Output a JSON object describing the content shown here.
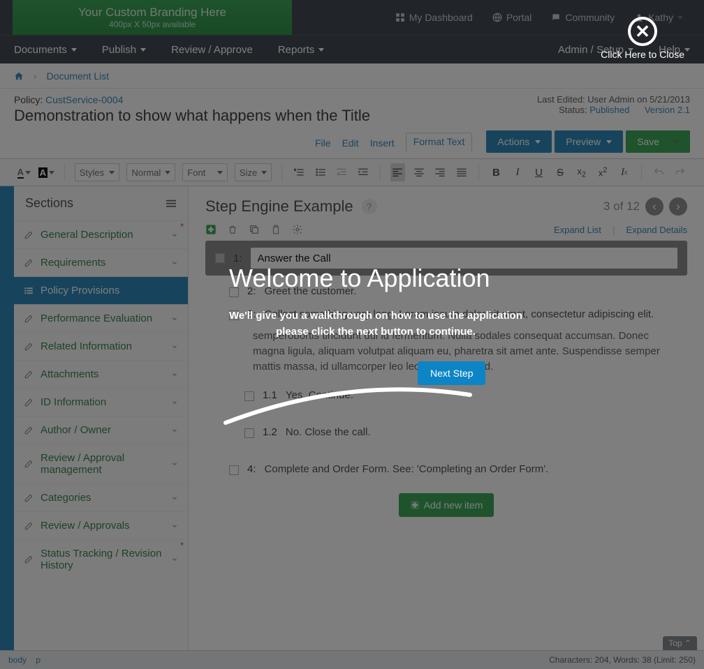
{
  "brand": {
    "line1": "Your Custom Branding Here",
    "line2": "400px X 50px available"
  },
  "topnav": {
    "dashboard": "My Dashboard",
    "portal": "Portal",
    "community": "Community",
    "user": "Kathy"
  },
  "menubar": {
    "documents": "Documents",
    "publish": "Publish",
    "review": "Review / Approve",
    "reports": "Reports",
    "admin": "Admin / Setup",
    "help": "Help"
  },
  "breadcrumb": {
    "current": "Document List"
  },
  "policy": {
    "label": "Policy:",
    "code": "CustService-0004",
    "title": "Demonstration to show what happens when the Title",
    "last_edited": "Last Edited: User Admin on 5/21/2013",
    "status_label": "Status:",
    "status_value": "Published",
    "version": "Version 2.1"
  },
  "tabs": {
    "file": "File",
    "edit": "Edit",
    "insert": "Insert",
    "format": "Format Text"
  },
  "buttons": {
    "actions": "Actions",
    "preview": "Preview",
    "save": "Save"
  },
  "toolbar": {
    "styles": "Styles",
    "normal": "Normal",
    "font": "Font",
    "size": "Size"
  },
  "sidebar": {
    "title": "Sections",
    "items": [
      "General Description",
      "Requirements",
      "Policy Provisions",
      "Performance Evaluation",
      "Related Information",
      "Attachments",
      "ID Information",
      "Author / Owner",
      "Review / Approval management",
      "Categories",
      "Review / Approvals",
      "Status Tracking / Revision History"
    ]
  },
  "content": {
    "title": "Step Engine Example",
    "pager": "3 of 12",
    "expand_list": "Expand List",
    "expand_details": "Expand Details",
    "step1_num": "1:",
    "step1_value": "Answer the Call",
    "step2_num": "2:",
    "step2_text": "Greet the customer.",
    "step3_num": "3:",
    "step3_text": "Collect something very long.  Lorem ipsum dolor sit amet, consectetur adipiscing elit.",
    "step3_para": "semperobortis tincidunt dui id fermentum. Nulla sodales consequat accumsan. Donec magna ligula, aliquam volutpat aliquam eu, pharetra sit amet ante. Suspendisse semper mattis massa, id ullamcorper leo lectus imperdiet id.",
    "step11_num": "1.1",
    "step11_text": "Yes. Continue.",
    "step12_num": "1.2",
    "step12_text": "No. Close the call.",
    "step4_num": "4:",
    "step4_text": "Complete and Order Form. See: 'Completing an Order Form'.",
    "add_new": "Add new item"
  },
  "footer": {
    "top": "Top",
    "path_body": "body",
    "path_p": "p",
    "stats": "Characters: 204, Words: 38 (Limit: 250)"
  },
  "overlay": {
    "close": "Click Here to Close",
    "heading": "Welcome to Application",
    "body": "We'll give you a walkthrough on how to use the application please click the next button to continue.",
    "next": "Next Step"
  }
}
